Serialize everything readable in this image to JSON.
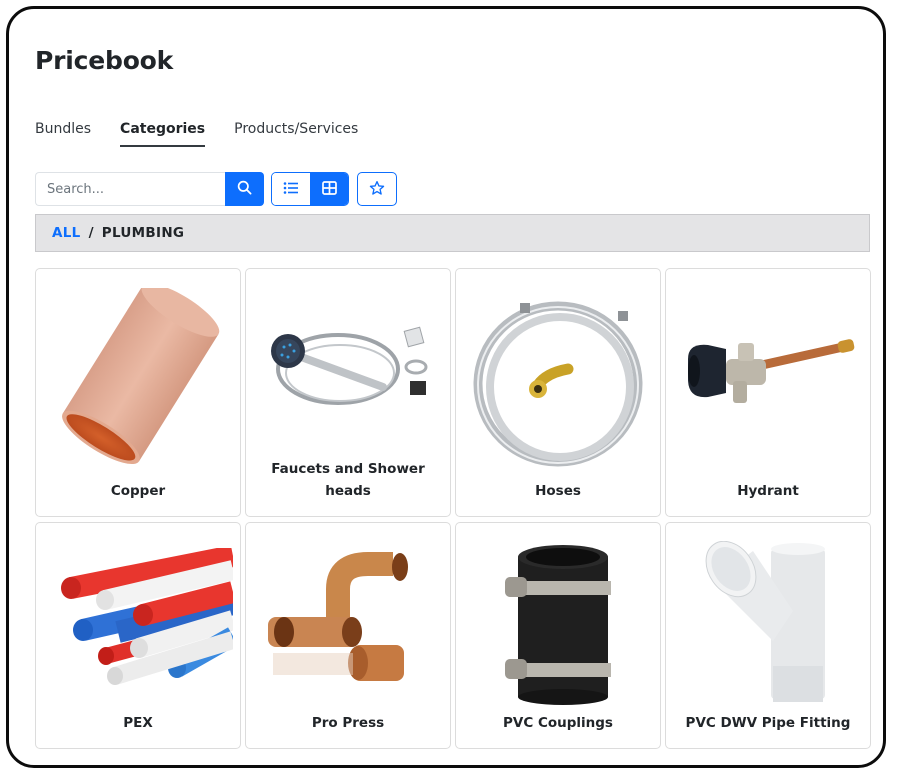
{
  "page": {
    "title": "Pricebook"
  },
  "tabs": [
    {
      "label": "Bundles",
      "active": false
    },
    {
      "label": "Categories",
      "active": true
    },
    {
      "label": "Products/Services",
      "active": false
    }
  ],
  "toolbar": {
    "search_placeholder": "Search...",
    "search_value": "",
    "search_icon": "search-icon",
    "view_list_icon": "list-view-icon",
    "view_grid_icon": "grid-view-icon",
    "view_mode": "grid",
    "favorite_icon": "star-icon"
  },
  "breadcrumb": {
    "root": "ALL",
    "separator": "/",
    "current": "PLUMBING"
  },
  "colors": {
    "accent": "#0d6efd",
    "breadcrumb_bg": "#e4e4e6",
    "text": "#212529"
  },
  "categories": [
    {
      "label": "Copper",
      "image": "copper-coupling-image"
    },
    {
      "label": "Faucets and Shower heads",
      "image": "shower-head-kit-image"
    },
    {
      "label": "Hoses",
      "image": "braided-hose-image"
    },
    {
      "label": "Hydrant",
      "image": "wall-hydrant-image"
    },
    {
      "label": "PEX",
      "image": "pex-tubing-image"
    },
    {
      "label": "Pro Press",
      "image": "propress-fittings-image"
    },
    {
      "label": "PVC Couplings",
      "image": "rubber-coupling-image"
    },
    {
      "label": "PVC DWV Pipe Fitting",
      "image": "pvc-wye-fitting-image"
    }
  ]
}
